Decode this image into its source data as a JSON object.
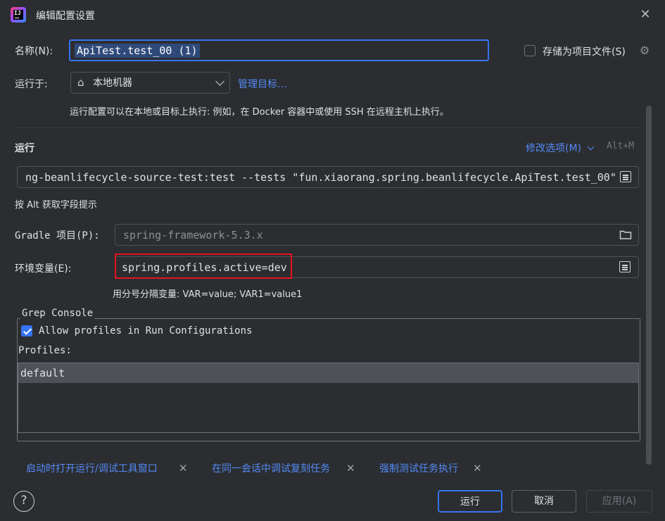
{
  "window": {
    "title": "编辑配置设置"
  },
  "name_row": {
    "label": "名称(N):",
    "value": "ApiTest.test_00 (1)"
  },
  "store_option": {
    "label": "存储为项目文件(S)",
    "checked": false
  },
  "run_on": {
    "label": "运行于:",
    "selected": "本地机器",
    "manage_link": "管理目标…"
  },
  "run_hint": "运行配置可以在本地或目标上执行: 例如，在 Docker 容器中或使用 SSH 在远程主机上执行。",
  "run_section": {
    "header": "运行",
    "modify_options": "修改选项(M)",
    "shortcut": "Alt+M",
    "command": "ng-beanlifecycle-source-test:test --tests \"fun.xiaorang.spring.beanlifecycle.ApiTest.test_00\"",
    "alt_hint": "按 Alt 获取字段提示"
  },
  "gradle": {
    "label": "Gradle 项目(P):",
    "value": "spring-framework-5.3.x"
  },
  "env": {
    "label": "环境变量(E):",
    "value": "spring.profiles.active=dev",
    "hint": "用分号分隔变量: VAR=value; VAR1=value1"
  },
  "grep_console": {
    "legend": "Grep Console",
    "allow_label": "Allow profiles in Run Configurations",
    "allow_checked": true,
    "profiles_label": "Profiles:",
    "profiles": [
      "default"
    ]
  },
  "chips": [
    {
      "label": "启动时打开运行/调试工具窗口"
    },
    {
      "label": "在同一会话中调试复刻任务"
    },
    {
      "label": "强制测试任务执行"
    }
  ],
  "buttons": {
    "help": "?",
    "run": "运行",
    "cancel": "取消",
    "apply": "应用(A)"
  },
  "colors": {
    "accent": "#3574f0",
    "link": "#548af7",
    "highlight_box": "#e5131f",
    "background": "#2b2d30"
  }
}
